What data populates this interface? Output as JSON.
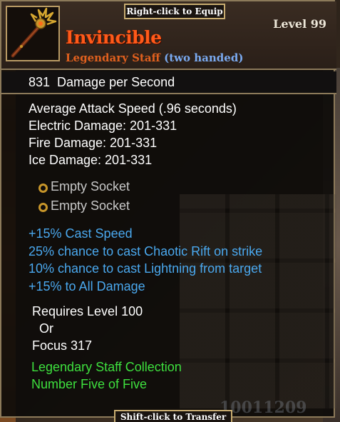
{
  "header": {
    "equip_hint": "Right-click to Equip",
    "level": "Level 99",
    "item_name": "Invincible",
    "item_type": "Legendary Staff",
    "item_hand": "(two handed)",
    "icon": "staff-icon"
  },
  "dps": {
    "value": "831",
    "label": "Damage per Second"
  },
  "stats": [
    "Average Attack Speed (.96 seconds)",
    "Electric Damage: 201-331",
    "Fire Damage: 201-331",
    "Ice Damage: 201-331"
  ],
  "sockets": [
    "Empty Socket",
    "Empty Socket"
  ],
  "magic_properties": [
    "+15% Cast Speed",
    "25% chance to cast Chaotic Rift on strike",
    "10% chance to cast Lightning from target",
    "+15% to All Damage"
  ],
  "requirements": [
    "Requires Level 100",
    "Or",
    "Focus 317"
  ],
  "collection": [
    "Legendary Staff Collection",
    "Number Five of Five"
  ],
  "footer": {
    "transfer_hint": "Shift-click to Transfer",
    "gold_ghost": "10011209"
  },
  "colors": {
    "item_name": "#ff5a1a",
    "item_type": "#e0601e",
    "hand": "#7aaaf0",
    "magic": "#4aa8ee",
    "collection": "#3ee03e",
    "border": "#8c7a5a",
    "socket_ring": "#c8962a"
  }
}
